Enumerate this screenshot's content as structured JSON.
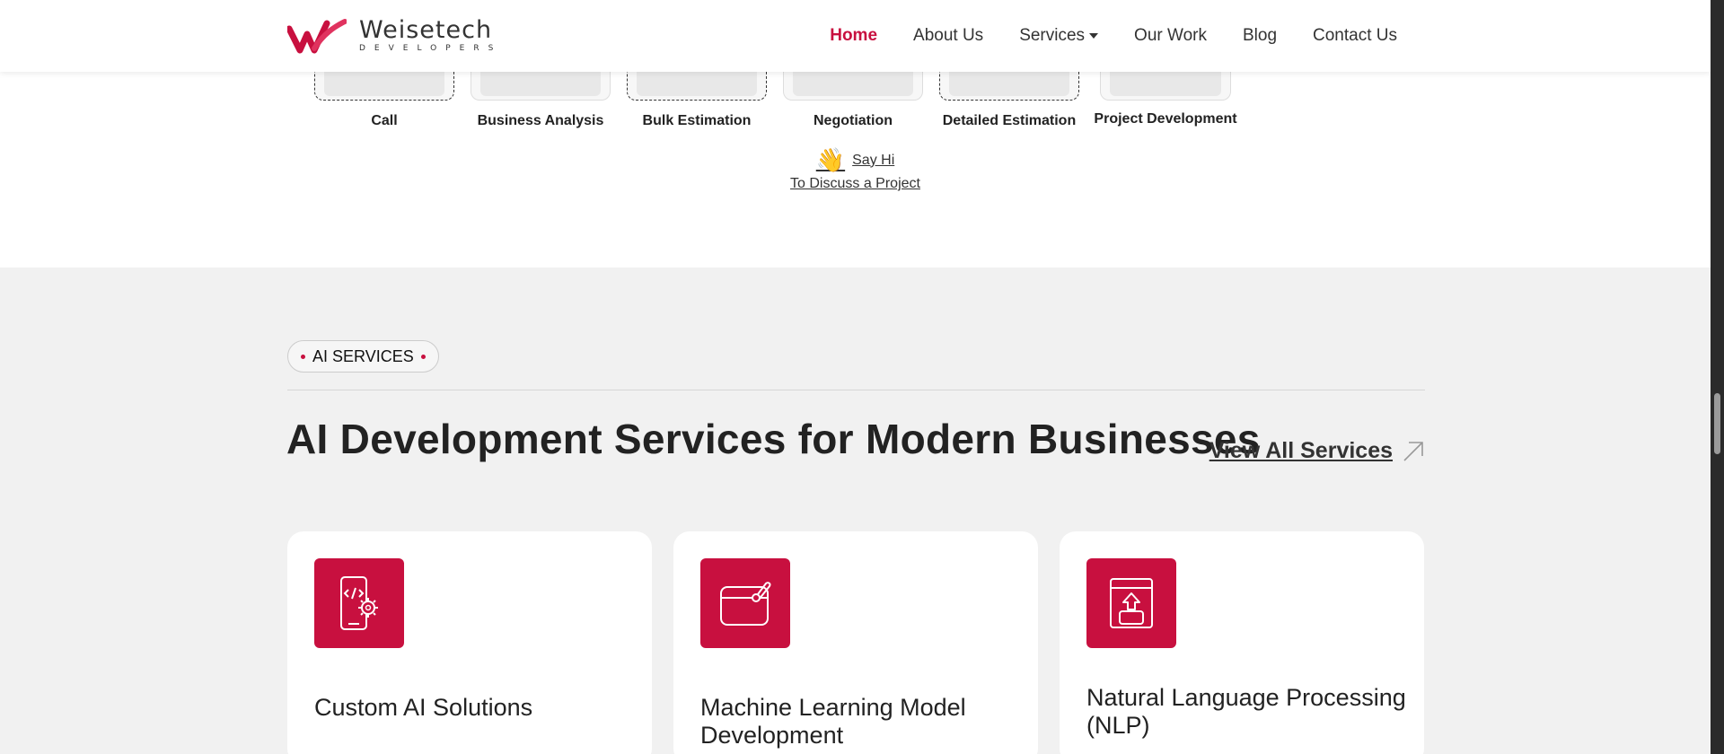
{
  "brand": {
    "name": "Weisetech",
    "tagline": "DEVELOPERS",
    "accent": "#c8103f"
  },
  "nav": {
    "items": [
      {
        "label": "Home",
        "active": true
      },
      {
        "label": "About Us"
      },
      {
        "label": "Services",
        "dropdown": true
      },
      {
        "label": "Our Work"
      },
      {
        "label": "Blog"
      },
      {
        "label": "Contact Us"
      }
    ]
  },
  "process": {
    "steps": [
      {
        "label": "Call"
      },
      {
        "label": "Business Analysis"
      },
      {
        "label": "Bulk Estimation"
      },
      {
        "label": "Negotiation"
      },
      {
        "label": "Detailed Estimation"
      },
      {
        "label": "Project Development"
      }
    ],
    "cta": {
      "line1": "Say Hi",
      "line2": "To Discuss a Project",
      "icon": "waving-hand-icon"
    }
  },
  "ai_section": {
    "badge": "AI SERVICES",
    "title": "AI Development Services for Modern Businesses",
    "view_all": "View All Services",
    "cards": [
      {
        "title": "Custom AI Solutions",
        "icon": "mobile-code-gear-icon"
      },
      {
        "title": "Machine Learning Model Development",
        "icon": "browser-brush-icon"
      },
      {
        "title": "Natural Language Processing (NLP)",
        "icon": "document-upload-icon"
      }
    ]
  }
}
